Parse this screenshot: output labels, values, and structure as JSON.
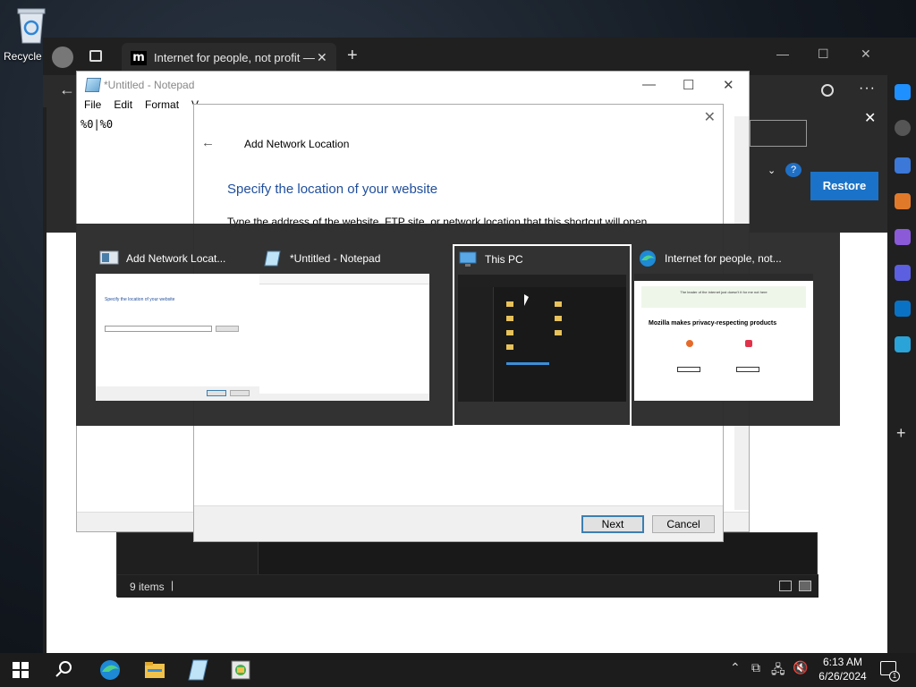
{
  "desktop": {
    "recycle_label": "Recycle"
  },
  "edge": {
    "tab_title": "Internet for people, not profit —",
    "tab_favicon": "m",
    "newtab": "+",
    "restore_label": "Restore"
  },
  "notepad": {
    "title": "*Untitled - Notepad",
    "menu": [
      "File",
      "Edit",
      "Format",
      "V"
    ],
    "content": "%0|%0"
  },
  "wizard": {
    "title": "Add Network Location",
    "heading": "Specify the location of your website",
    "description": "Type the address of the website, FTP site, or network location that this shortcut will open.",
    "next_label": "Next",
    "cancel_label": "Cancel"
  },
  "explorer": {
    "status": "9 items"
  },
  "switcher": {
    "items": [
      {
        "label": "Add Network Locat...",
        "icon": "network-location-icon"
      },
      {
        "label": "*Untitled - Notepad",
        "icon": "notepad-icon"
      },
      {
        "label": "This PC",
        "icon": "this-pc-icon",
        "selected": true
      },
      {
        "label": "Internet for people, not...",
        "icon": "edge-icon"
      }
    ],
    "thumb_texts": {
      "wizard_heading": "Specify the location of your website",
      "mozilla_banner": "The leader of the internet just doesn't it for me not here",
      "mozilla_heading": "Mozilla makes privacy-respecting products"
    }
  },
  "taskbar": {
    "time": "6:13 AM",
    "date": "6/26/2024",
    "notification_count": "1"
  },
  "colors": {
    "accent_blue": "#1a73c8",
    "wizard_heading": "#1f4e9c",
    "taskbar": "#1c1c1c"
  }
}
